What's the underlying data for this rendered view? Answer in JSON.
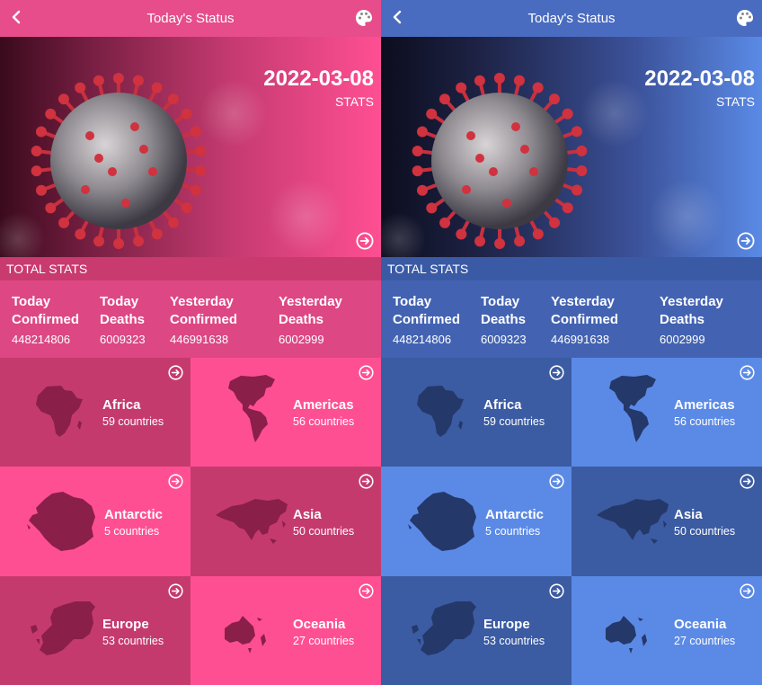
{
  "appbar": {
    "title": "Today's Status",
    "back_icon": "back-chevron-icon",
    "theme_icon": "palette-icon"
  },
  "hero": {
    "date": "2022-03-08",
    "stats_label": "STATS",
    "arrow_icon": "arrow-circle-right-icon"
  },
  "total": {
    "header": "TOTAL STATS",
    "items": [
      {
        "label": "Today Confirmed",
        "value": "448214806"
      },
      {
        "label": "Today Deaths",
        "value": "6009323"
      },
      {
        "label": "Yesterday Confirmed",
        "value": "446991638"
      },
      {
        "label": "Yesterday Deaths",
        "value": "6002999"
      }
    ]
  },
  "regions": [
    {
      "name": "Africa",
      "count": "59 countries"
    },
    {
      "name": "Americas",
      "count": "56 countries"
    },
    {
      "name": "Antarctic",
      "count": "5 countries"
    },
    {
      "name": "Asia",
      "count": "50 countries"
    },
    {
      "name": "Europe",
      "count": "53 countries"
    },
    {
      "name": "Oceania",
      "count": "27 countries"
    }
  ],
  "themes": {
    "pink": "#ff4f93",
    "blue": "#5b8ae6"
  }
}
